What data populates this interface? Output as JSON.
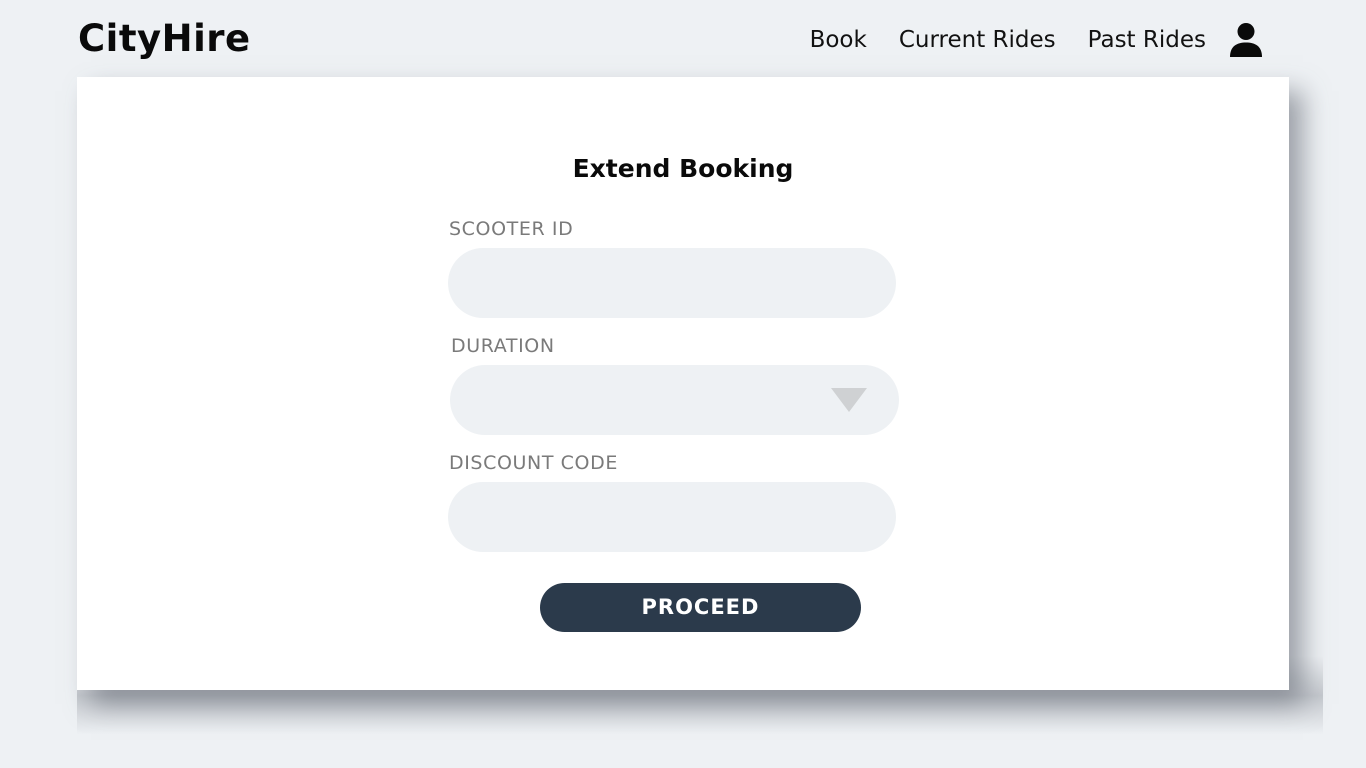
{
  "header": {
    "logo": "CityHire",
    "nav": [
      {
        "label": "Book"
      },
      {
        "label": "Current Rides"
      },
      {
        "label": "Past Rides"
      }
    ],
    "avatar_icon": "user-icon"
  },
  "form": {
    "title": "Extend Booking",
    "scooter_id": {
      "label": "SCOOTER ID",
      "value": "",
      "placeholder": ""
    },
    "duration": {
      "label": "DURATION",
      "value": "",
      "icon": "dropdown-arrow-icon"
    },
    "discount_code": {
      "label": "DISCOUNT CODE",
      "value": "",
      "placeholder": ""
    },
    "submit_label": "PROCEED"
  },
  "colors": {
    "page_background": "#eef1f4",
    "card_background": "#ffffff",
    "field_background": "#eef1f4",
    "button_background": "#2b3a4b",
    "button_text": "#ffffff",
    "label_text": "#7a7a7a"
  }
}
